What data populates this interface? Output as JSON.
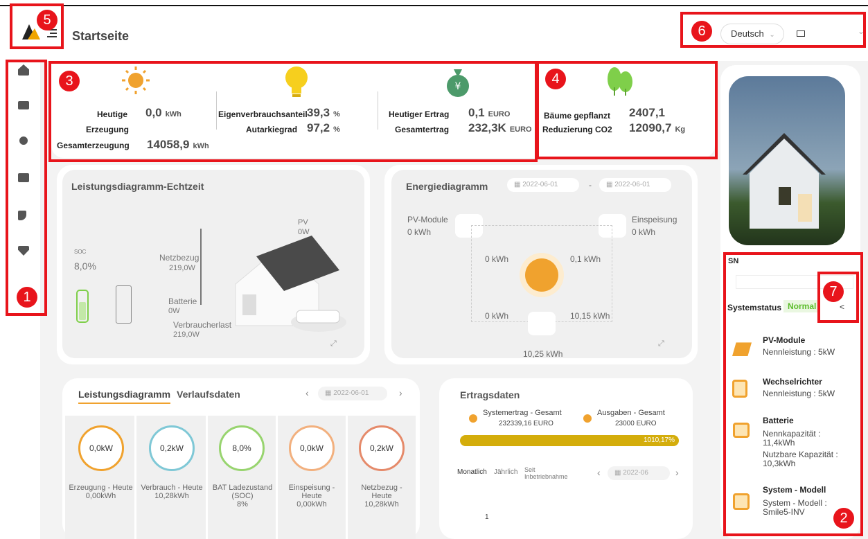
{
  "header": {
    "title": "Startseite",
    "language": "Deutsch"
  },
  "badges": [
    "1",
    "2",
    "3",
    "4",
    "5",
    "6",
    "7"
  ],
  "stats": {
    "heutige_label": "Heutige",
    "erzeugung_label": "Erzeugung",
    "heutige_value": "0,0",
    "heutige_unit": "kWh",
    "gesamt_label": "Gesamterzeugung",
    "gesamt_value": "14058,9",
    "gesamt_unit": "kWh",
    "eigen_label": "Eigenverbrauchsanteil",
    "eigen_value": "39,3",
    "eigen_unit": "%",
    "autark_label": "Autarkiegrad",
    "autark_value": "97,2",
    "autark_unit": "%",
    "ertrag_label": "Heutiger Ertrag",
    "ertrag_value": "0,1",
    "ertrag_unit": "EURO",
    "gesamtertrag_label": "Gesamtertrag",
    "gesamtertrag_value": "232,3K",
    "gesamtertrag_unit": "EURO",
    "baeume_label": "Bäume gepflanzt",
    "baeume_value": "2407,1",
    "co2_label": "Reduzierung CO2",
    "co2_value": "12090,7",
    "co2_unit": "Kg"
  },
  "realtime": {
    "title": "Leistungsdiagramm-Echtzeit",
    "soc_label": "SOC",
    "soc_value": "8,0%",
    "pv_label": "PV",
    "pv_value": "0W",
    "netz_label": "Netzbezug",
    "netz_value": "219,0W",
    "batt_label": "Batterie",
    "batt_value": "0W",
    "verb_label": "Verbraucherlast",
    "verb_value": "219,0W"
  },
  "energy": {
    "title": "Energiediagramm",
    "date_from": "2022-06-01",
    "date_sep": "-",
    "date_to": "2022-06-01",
    "pv_label": "PV-Module",
    "pv_value": "0 kWh",
    "ein_label": "Einspeisung",
    "ein_value": "0 kWh",
    "f1": "0 kWh",
    "f2": "0,1 kWh",
    "f3": "0 kWh",
    "f4": "10,15 kWh",
    "home": "10,25 kWh"
  },
  "power": {
    "tab1": "Leistungsdiagramm",
    "tab2": "Verlaufsdaten",
    "date": "2022-06-01",
    "gauges": [
      {
        "value": "0,0kW",
        "l1": "Erzeugung - Heute",
        "l2": "0,00kWh",
        "l3": ""
      },
      {
        "value": "0,2kW",
        "l1": "Verbrauch - Heute",
        "l2": "10,28kWh",
        "l3": ""
      },
      {
        "value": "8,0%",
        "l1": "BAT Ladezustand",
        "l2": "(SOC)",
        "l3": "8%"
      },
      {
        "value": "0,0kW",
        "l1": "Einspeisung -",
        "l2": "Heute",
        "l3": "0,00kWh"
      },
      {
        "value": "0,2kW",
        "l1": "Netzbezug -",
        "l2": "Heute",
        "l3": "10,28kWh"
      }
    ]
  },
  "ertrag": {
    "title": "Ertragsdaten",
    "sys_label": "Systemertrag - Gesamt",
    "sys_value": "232339,16 EURO",
    "aus_label": "Ausgaben - Gesamt",
    "aus_value": "23000 EURO",
    "progress": 1,
    "progress_label": "1010,17%",
    "tab1": "Monatlich",
    "tab2": "Jährlich",
    "tab3a": "Seit",
    "tab3b": "Inbetriebnahme",
    "date": "2022-06",
    "axis": "1"
  },
  "device": {
    "sn_label": "SN",
    "status_label": "Systemstatus",
    "status_value": "Normal",
    "items": [
      {
        "title": "PV-Module",
        "t1": "Nennleistung : 5kW",
        "t2": ""
      },
      {
        "title": "Wechselrichter",
        "t1": "Nennleistung : 5kW",
        "t2": ""
      },
      {
        "title": "Batterie",
        "t1": "Nennkapazität : 11,4kWh",
        "t2": "Nutzbare Kapazität : 10,3kWh"
      },
      {
        "title": "System - Modell",
        "t1": "System - Modell : Smile5-INV",
        "t2": ""
      }
    ]
  }
}
